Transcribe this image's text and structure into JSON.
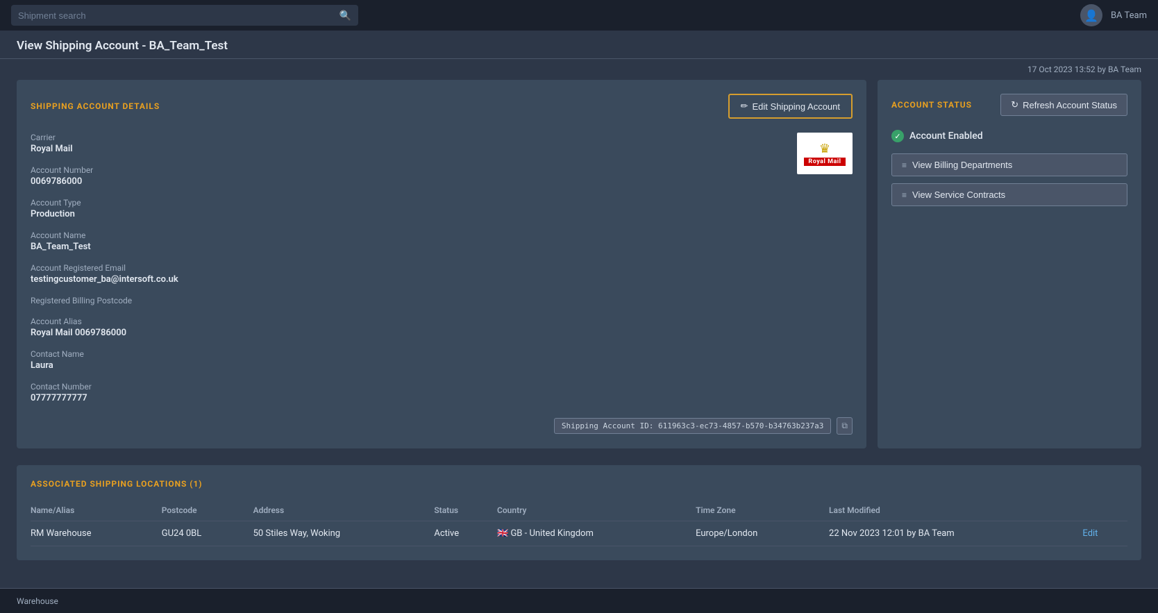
{
  "nav": {
    "search_placeholder": "Shipment search",
    "user_name": "BA Team"
  },
  "page": {
    "title": "View Shipping Account - BA_Team_Test",
    "meta": "17 Oct 2023 13:52 by BA Team"
  },
  "shipping_account": {
    "section_title": "SHIPPING ACCOUNT DETAILS",
    "edit_button": "Edit Shipping Account",
    "fields": [
      {
        "label": "Carrier",
        "value": "Royal Mail"
      },
      {
        "label": "Account Number",
        "value": "0069786000"
      },
      {
        "label": "Account Type",
        "value": "Production"
      },
      {
        "label": "Account Name",
        "value": "BA_Team_Test"
      },
      {
        "label": "Account Registered Email",
        "value": "testingcustomer_ba@intersoft.co.uk"
      },
      {
        "label": "Registered Billing Postcode",
        "value": ""
      },
      {
        "label": "Account Alias",
        "value": "Royal Mail 0069786000"
      },
      {
        "label": "Contact Name",
        "value": "Laura"
      },
      {
        "label": "Contact Number",
        "value": "07777777777"
      }
    ],
    "account_id_label": "Shipping Account ID: 611963c3-ec73-4857-b570-b34763b237a3"
  },
  "account_status": {
    "section_title": "ACCOUNT STATUS",
    "refresh_button": "Refresh Account Status",
    "status_label": "Account Enabled",
    "view_billing_button": "View Billing Departments",
    "view_contracts_button": "View Service Contracts"
  },
  "locations": {
    "section_title": "ASSOCIATED SHIPPING LOCATIONS (1)",
    "columns": [
      "Name/Alias",
      "Postcode",
      "Address",
      "Status",
      "Country",
      "Time Zone",
      "Last Modified",
      ""
    ],
    "rows": [
      {
        "name": "RM Warehouse",
        "postcode": "GU24 0BL",
        "address": "50 Stiles Way, Woking",
        "status": "Active",
        "country": "🇬🇧 GB - United Kingdom",
        "timezone": "Europe/London",
        "last_modified": "22 Nov 2023 12:01 by BA Team",
        "action": "Edit"
      }
    ]
  },
  "bottom_nav": {
    "items": [
      "Warehouse"
    ]
  },
  "icons": {
    "search": "🔍",
    "edit_pencil": "✏",
    "refresh": "↻",
    "list": "≡",
    "copy": "⧉",
    "check": "✓",
    "user": "👤"
  }
}
